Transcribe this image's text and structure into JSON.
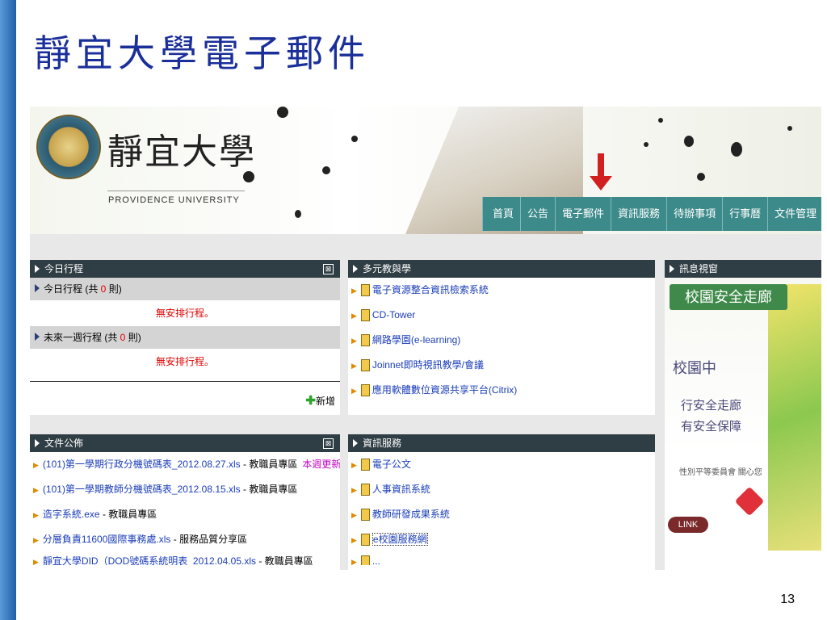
{
  "slide": {
    "title": "靜宜大學電子郵件",
    "page_number": "13"
  },
  "header": {
    "logo_cn": "靜宜大學",
    "logo_en": "PROVIDENCE UNIVERSITY",
    "nav": [
      "首頁",
      "公告",
      "電子郵件",
      "資訊服務",
      "待辦事項",
      "行事曆",
      "文件管理"
    ],
    "highlighted_nav": "電子郵件"
  },
  "today": {
    "title": "今日行程",
    "close": "⊠",
    "today_count_prefix": "今日行程 (共 ",
    "today_count": "0",
    "today_count_suffix": " 則)",
    "today_empty": "無安排行程。",
    "week_count_prefix": "未來一週行程 (共 ",
    "week_count": "0",
    "week_count_suffix": " 則)",
    "week_empty": "無安排行程。",
    "add_label": "新增"
  },
  "multi": {
    "title": "多元教與學",
    "items": [
      "電子資源整合資訊檢索系統",
      "CD-Tower",
      "網路學園(e-learning)",
      "Joinnet即時視訊教學/會議",
      "應用軟體數位資源共享平台(Citrix)"
    ]
  },
  "info": {
    "title": "訊息視窗",
    "safety": "校園安全走廊",
    "campus": "校園中",
    "slogan1": "行安全走廊",
    "slogan2": "有安全保障",
    "caring": "性別平等委員會 關心您",
    "link": "LINK"
  },
  "docs": {
    "title": "文件公佈",
    "close": "⊠",
    "items": [
      {
        "name": "(101)第一學期行政分機號碼表_2012.08.27.xls",
        "suffix": " - 教職員專區",
        "tag": "本週更新"
      },
      {
        "name": "(101)第一學期教師分機號碼表_2012.08.15.xls",
        "suffix": " - 教職員專區",
        "tag": ""
      },
      {
        "name": "造字系統.exe",
        "suffix": " - 教職員專區",
        "tag": ""
      },
      {
        "name": "分層負責11600國際事務處.xls",
        "suffix": " - 服務品質分享區",
        "tag": ""
      },
      {
        "name": "靜宜大學DID（DOD號碼系統明表_2012.04.05.xls",
        "suffix": " - 教職員專區",
        "tag": ""
      }
    ]
  },
  "services": {
    "title": "資訊服務",
    "items": [
      "電子公文",
      "人事資訊系統",
      "教師研發成果系統",
      "e校園服務網",
      "..."
    ]
  }
}
